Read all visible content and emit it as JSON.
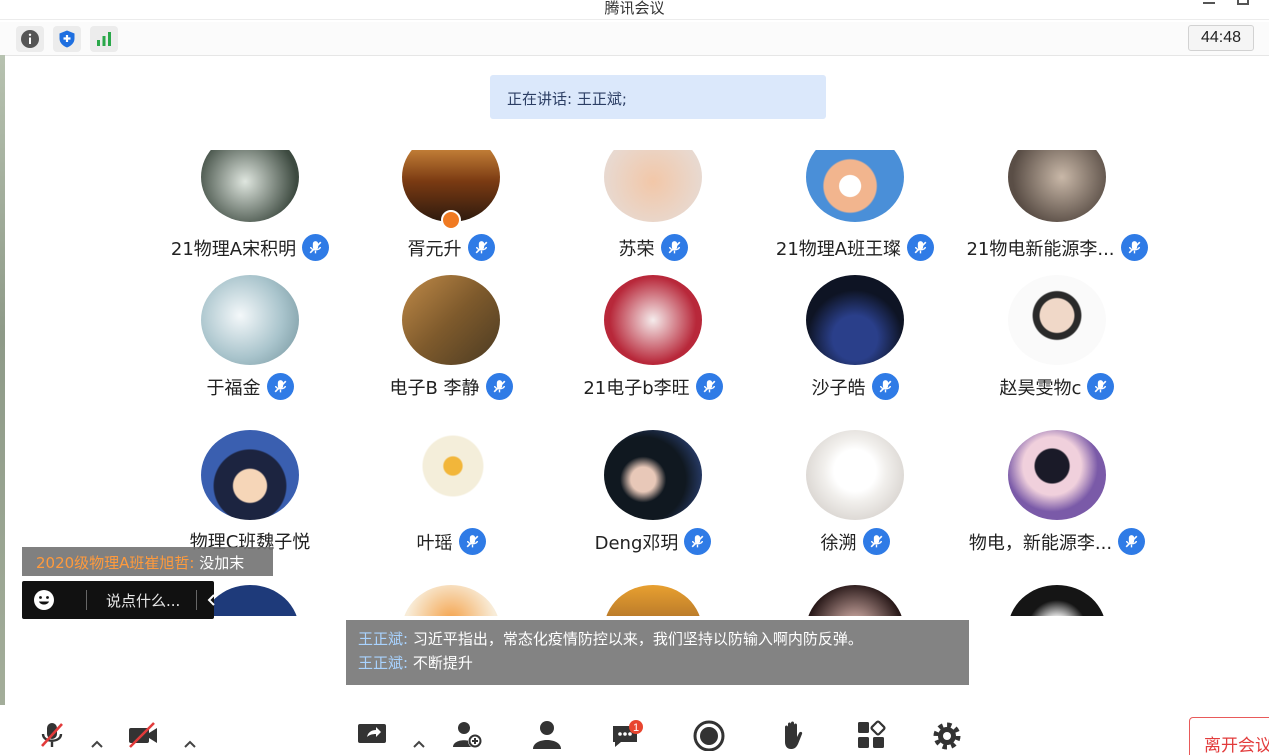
{
  "window": {
    "title": "腾讯会议"
  },
  "status_bar": {
    "timer": "44:48"
  },
  "speaking": {
    "label": "正在讲话:",
    "names": "王正斌;"
  },
  "participants": [
    {
      "name": "21物理A宋积明"
    },
    {
      "name": "胥元升"
    },
    {
      "name": "苏荣"
    },
    {
      "name": "21物理A班王璨"
    },
    {
      "name": "21物电新能源李..."
    },
    {
      "name": "于福金"
    },
    {
      "name": "电子B  李静"
    },
    {
      "name": "21电子b李旺"
    },
    {
      "name": "沙子皓"
    },
    {
      "name": "赵昊雯物c"
    },
    {
      "name": "物理C班魏子悦"
    },
    {
      "name": "叶瑶"
    },
    {
      "name": "Deng邓玥"
    },
    {
      "name": "徐溯"
    },
    {
      "name": "物电，新能源李..."
    }
  ],
  "chat": {
    "sender": "2020级物理A班崔旭哲:",
    "message": "没加末",
    "input_placeholder": "说点什么..."
  },
  "subtitles": [
    {
      "speaker": "王正斌:",
      "text": "习近平指出，常态化疫情防控以来，我们坚持以防输入啊内防反弹。"
    },
    {
      "speaker": "王正斌:",
      "text": "不断提升"
    }
  ],
  "toolbar": {
    "chat_badge": "1",
    "leave_label": "离开会议"
  },
  "colors": {
    "accent": "#2f7be6",
    "leave": "#e23b3b",
    "chat_sender": "#ff9a3c",
    "speaking_bg": "#dbe8fb"
  }
}
